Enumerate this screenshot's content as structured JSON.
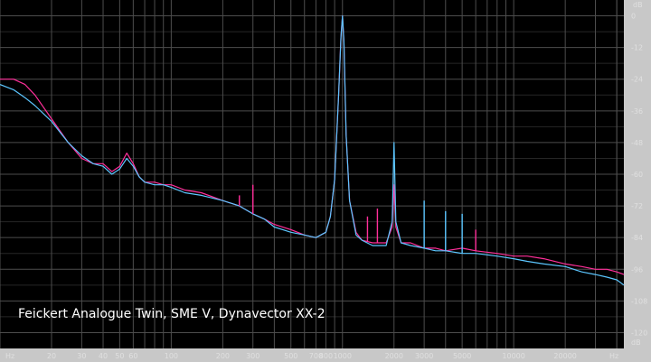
{
  "colors": {
    "background": "#000000",
    "grid": "#4d4d4d",
    "trace_pink": "#ff2f9a",
    "trace_blue": "#5cc6ff",
    "axis_panel": "#c8c8c8"
  },
  "chart_data": {
    "type": "line",
    "title": "Feickert Analogue Twin, SME V, Dynavector XX-2",
    "x_unit_label": "Hz",
    "y_unit_label": "dB",
    "x_scale": "log",
    "xlim": [
      10,
      44000
    ],
    "ylim": [
      -126,
      6
    ],
    "grid": true,
    "y_ticks": [
      0,
      -12,
      -24,
      -36,
      -48,
      -60,
      -72,
      -84,
      -96,
      -108,
      -120
    ],
    "y_tick_labels": [
      "0",
      "-12",
      "-24",
      "-36",
      "-48",
      "-60",
      "-72",
      "-84",
      "-96",
      "-108",
      "-120"
    ],
    "x_ticks_labeled": [
      20,
      30,
      40,
      50,
      60,
      100,
      200,
      300,
      500,
      700,
      800,
      1000,
      2000,
      3000,
      5000,
      10000,
      20000
    ],
    "x_tick_labels": [
      "20",
      "30",
      "40",
      "50",
      "60",
      "100",
      "200",
      "300",
      "500",
      "700",
      "800",
      "1000",
      "2000",
      "3000",
      "5000",
      "10000",
      "20000"
    ],
    "series": [
      {
        "color": "#ff2f9a",
        "x": [
          10,
          12,
          14,
          16,
          20,
          25,
          30,
          35,
          40,
          45,
          50,
          55,
          60,
          65,
          70,
          80,
          90,
          100,
          120,
          150,
          200,
          250,
          300,
          350,
          400,
          500,
          600,
          700,
          800,
          850,
          900,
          950,
          980,
          1000,
          1020,
          1050,
          1100,
          1200,
          1300,
          1500,
          1800,
          1950,
          2000,
          2050,
          2200,
          2500,
          3000,
          3500,
          4000,
          5000,
          6000,
          8000,
          10000,
          12000,
          15000,
          20000,
          25000,
          30000,
          35000,
          40000,
          44000
        ],
        "y": [
          -24,
          -24,
          -26,
          -30,
          -39,
          -48,
          -54,
          -56,
          -56,
          -59,
          -57,
          -52,
          -56,
          -61,
          -63,
          -63,
          -64,
          -64,
          -66,
          -67,
          -70,
          -72,
          -75,
          -77,
          -79,
          -81,
          -83,
          -84,
          -82,
          -76,
          -62,
          -30,
          -8,
          0,
          -10,
          -45,
          -70,
          -82,
          -85,
          -86,
          -86,
          -80,
          -64,
          -80,
          -86,
          -86,
          -88,
          -88,
          -89,
          -88,
          -89,
          -90,
          -91,
          -91,
          -92,
          -94,
          -95,
          -96,
          -96,
          -97,
          -98
        ]
      },
      {
        "color": "#5cc6ff",
        "x": [
          10,
          12,
          14,
          16,
          20,
          25,
          30,
          35,
          40,
          45,
          50,
          55,
          60,
          65,
          70,
          80,
          90,
          100,
          120,
          150,
          200,
          250,
          300,
          350,
          400,
          500,
          600,
          700,
          800,
          850,
          900,
          950,
          980,
          1000,
          1020,
          1050,
          1100,
          1200,
          1300,
          1500,
          1800,
          1950,
          2000,
          2050,
          2200,
          2500,
          3000,
          3500,
          4000,
          5000,
          6000,
          8000,
          10000,
          12000,
          15000,
          20000,
          25000,
          30000,
          35000,
          40000,
          44000
        ],
        "y": [
          -26,
          -28,
          -31,
          -34,
          -40,
          -48,
          -53,
          -56,
          -57,
          -60,
          -58,
          -54,
          -57,
          -61,
          -63,
          -64,
          -64,
          -65,
          -67,
          -68,
          -70,
          -72,
          -75,
          -77,
          -80,
          -82,
          -83,
          -84,
          -82,
          -76,
          -62,
          -30,
          -8,
          0,
          -10,
          -45,
          -70,
          -83,
          -85,
          -87,
          -87,
          -78,
          -48,
          -78,
          -86,
          -87,
          -88,
          -89,
          -89,
          -90,
          -90,
          -91,
          -92,
          -93,
          -94,
          -95,
          -97,
          -98,
          -99,
          -100,
          -102
        ]
      }
    ],
    "peaks": [
      {
        "series": 1,
        "x": 2000,
        "y": -48
      },
      {
        "series": 1,
        "x": 3000,
        "y": -70
      },
      {
        "series": 1,
        "x": 4000,
        "y": -74
      },
      {
        "series": 1,
        "x": 5000,
        "y": -75
      },
      {
        "series": 0,
        "x": 250,
        "y": -68
      },
      {
        "series": 0,
        "x": 300,
        "y": -64
      },
      {
        "series": 0,
        "x": 1400,
        "y": -76
      },
      {
        "series": 0,
        "x": 1600,
        "y": -73
      },
      {
        "series": 0,
        "x": 6000,
        "y": -81
      }
    ]
  }
}
